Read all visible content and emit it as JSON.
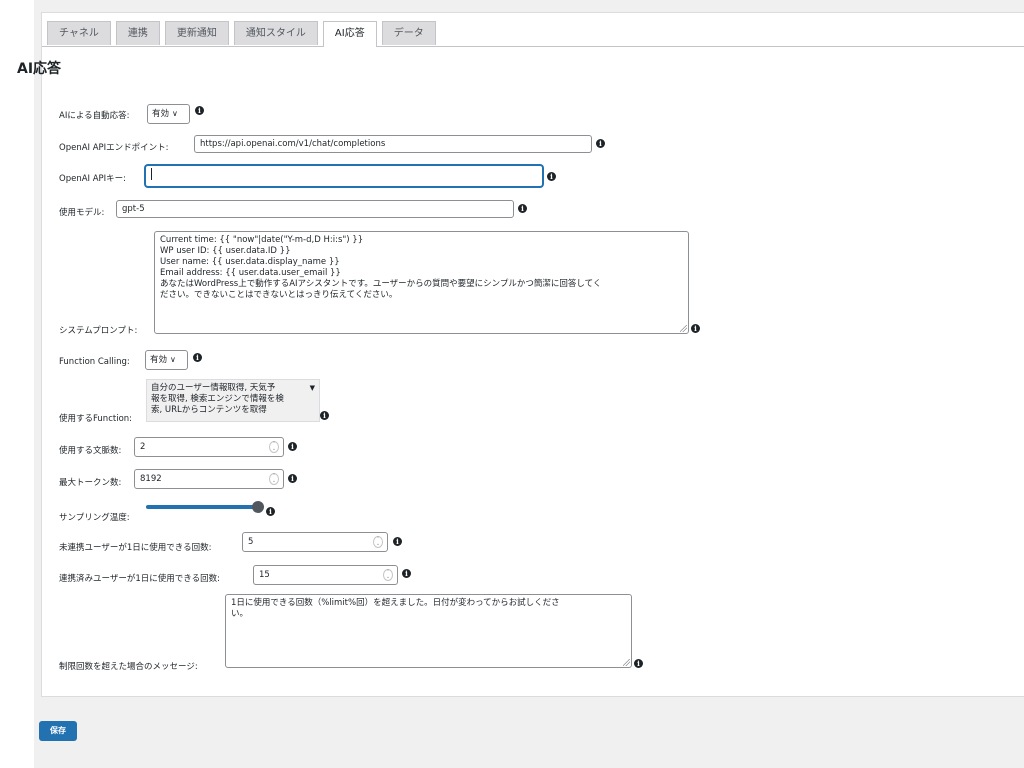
{
  "tabs": [
    {
      "label": "チャネル"
    },
    {
      "label": "連携"
    },
    {
      "label": "更新通知"
    },
    {
      "label": "通知スタイル"
    },
    {
      "label": "AI応答"
    },
    {
      "label": "データ"
    }
  ],
  "active_tab": "AI応答",
  "section_title": "AI応答",
  "fields": {
    "auto_reply": {
      "label": "AIによる自動応答:",
      "value": "有効"
    },
    "endpoint": {
      "label": "OpenAI APIエンドポイント:",
      "value": "https://api.openai.com/v1/chat/completions"
    },
    "api_key": {
      "label": "OpenAI APIキー:",
      "value": ""
    },
    "model": {
      "label": "使用モデル:",
      "value": "gpt-5"
    },
    "system_prompt": {
      "label": "システムプロンプト:",
      "lines": [
        "Current time: {{ \"now\"|date(\"Y-m-d,D H:i:s\") }}",
        "WP user ID: {{ user.data.ID }}",
        "User name: {{ user.data.display_name }}",
        "Email address: {{ user.data.user_email }}",
        "あなたはWordPress上で動作するAIアシスタントです。ユーザーからの質問や要望にシンプルかつ簡潔に回答してく",
        "ださい。できないことはできないとはっきり伝えてください。"
      ]
    },
    "function_calling": {
      "label": "Function Calling:",
      "value": "有効"
    },
    "functions": {
      "label": "使用するFunction:",
      "lines": [
        "自分のユーザー情報取得, 天気予",
        "報を取得, 検索エンジンで情報を検",
        "索, URLからコンテンツを取得"
      ]
    },
    "context_count": {
      "label": "使用する文脈数:",
      "value": "2"
    },
    "max_tokens": {
      "label": "最大トークン数:",
      "value": "8192"
    },
    "temperature": {
      "label": "サンプリング温度:",
      "level": 1.0
    },
    "unlinked_limit": {
      "label": "未連携ユーザーが1日に使用できる回数:",
      "value": "5"
    },
    "linked_limit": {
      "label": "連携済みユーザーが1日に使用できる回数:",
      "value": "15"
    },
    "limit_message": {
      "label": "制限回数を超えた場合のメッセージ:",
      "lines": [
        "1日に使用できる回数（%limit%回）を超えました。日付が変わってからお試しくださ",
        "い。"
      ]
    }
  },
  "save_label": "保存",
  "colors": {
    "accent": "#2271b1",
    "background": "#f0f0f1"
  }
}
